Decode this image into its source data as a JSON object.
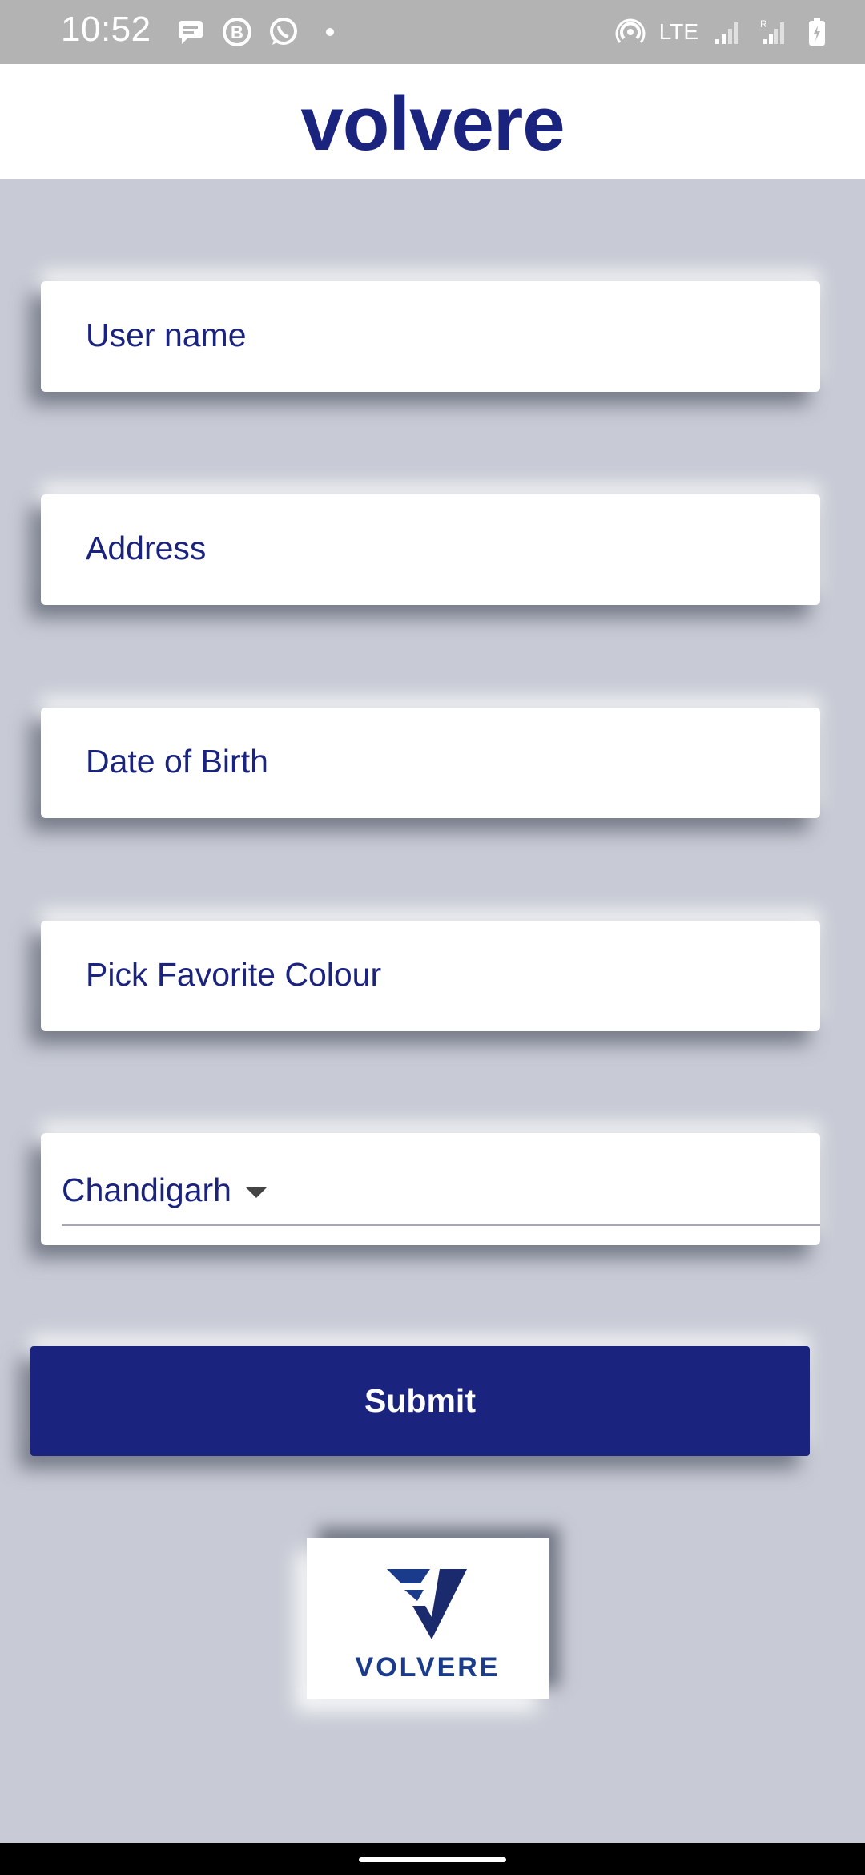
{
  "status_bar": {
    "time": "10:52",
    "network": "LTE",
    "icons": [
      "message-icon",
      "b-badge-icon",
      "whatsapp-icon",
      "dot-icon",
      "hotspot-icon",
      "signal-icon",
      "roaming-signal-icon",
      "battery-icon"
    ]
  },
  "app_bar": {
    "title": "volvere"
  },
  "form": {
    "username_placeholder": "User name",
    "address_placeholder": "Address",
    "dob_placeholder": "Date of Birth",
    "colour_placeholder": "Pick Favorite Colour",
    "city_selected": "Chandigarh",
    "submit_label": "Submit"
  },
  "logo": {
    "wordmark": "VOLVERE"
  },
  "colors": {
    "primary": "#1a237e",
    "background": "#c8cbd5",
    "status_bar": "#b3b3b3"
  }
}
